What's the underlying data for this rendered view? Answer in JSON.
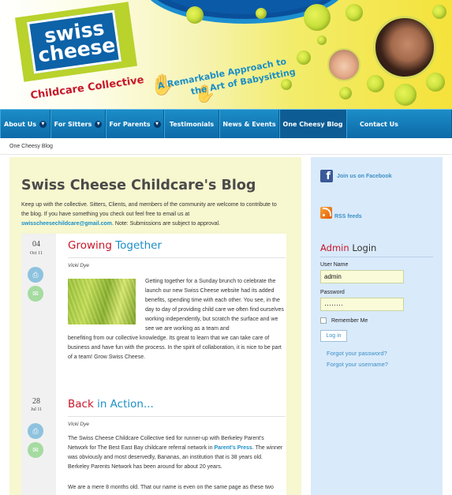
{
  "header": {
    "logo_line1": "swiss",
    "logo_line2": "cheese",
    "logo_sub": "Childcare Collective",
    "tagline_1": "A Remarkable Approach to",
    "tagline_2": "the Art of Babysitting"
  },
  "nav": {
    "items": [
      {
        "label": "About Us",
        "has_dropdown": true
      },
      {
        "label": "For Sitters",
        "has_dropdown": true
      },
      {
        "label": "For Parents",
        "has_dropdown": true
      },
      {
        "label": "Testimonials",
        "has_dropdown": false
      },
      {
        "label": "News & Events",
        "has_dropdown": false
      },
      {
        "label": "One Cheesy Blog",
        "has_dropdown": false,
        "active": true
      },
      {
        "label": "Contact Us",
        "has_dropdown": false
      }
    ]
  },
  "breadcrumb": "One Cheesy Blog",
  "main": {
    "title": "Swiss Cheese Childcare's Blog",
    "intro_1": "Keep up with the collective.  Sitters, Clients, and members of the community are welcome to contribute to the blog.  If you have something you check out feel free to email us at",
    "intro_email": "swisscheesechildcare@gmail.com",
    "intro_2": ".  Note:  Submissions are subject to approval."
  },
  "posts": [
    {
      "day": "04",
      "month": "Oct 11",
      "title_word1": "Growing",
      "title_word2": "Together",
      "author": "Vicki Dye",
      "text_a": "Getting together for a Sunday brunch to celebrate the launch our new Swiss Cheese website had its added benefits, spending time with each other. You see, in the day to day of providing child care we often find ourselves working independently, but scratch the surface and we see we are working as a team and",
      "text_b": "benefiting from our collective knowledge. Its great to learn that we can take care of business and have fun with the process. In the spirit of collaboration, it is nice to be part of a team! Grow Swiss Cheese."
    },
    {
      "day": "28",
      "month": "Jul 11",
      "title_word1": "Back",
      "title_word2": "in Action...",
      "author": "Vicki Dye",
      "text_a": "The Swiss Cheese Childcare Collective tied for runner-up with Berkeley Parent's Network for The Best East Bay childcare referral network in",
      "text_link": "Parent's Press",
      "text_b": ". The winner was obviously and most deservedly, Bananas, an institution that is 38 years old.  Berkeley Parents Network has been around for about 20 years.",
      "text_c": "We are a mere 8 months old. That our name is even on the same page as these two"
    }
  ],
  "sidebar": {
    "facebook_label": "Join us on Facebook",
    "rss_label": "RSS feeds",
    "login_word1": "Admin",
    "login_word2": "Login",
    "username_label": "User Name",
    "username_value": "admin",
    "password_label": "Password",
    "password_value": "········",
    "remember_label": "Remember Me",
    "login_button": "Log in",
    "forgot_password": "Forgot your password?",
    "forgot_username": "Forgot your username?"
  },
  "colors": {
    "nav_blue": "#1c8ec8",
    "brand_red": "#c8162a",
    "link_blue": "#1b8fc7",
    "sidebar_bg": "#d9eafb",
    "main_bg": "#f7f7d0"
  }
}
